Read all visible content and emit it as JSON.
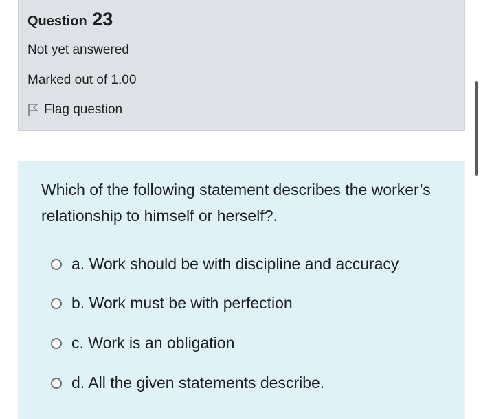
{
  "question": {
    "title_prefix": "Question",
    "number": "23",
    "state": "Not yet answered",
    "grade": "Marked out of 1.00",
    "flag_label": "Flag question",
    "text": "Which of the following statement describes the worker’s relationship to himself or herself?.",
    "answers": [
      {
        "label": "a. Work should be with discipline and accuracy"
      },
      {
        "label": "b. Work must be with perfection"
      },
      {
        "label": "c. Work is an obligation"
      },
      {
        "label": "d. All the given statements describe."
      }
    ]
  },
  "colors": {
    "info_background": "#dee2e6",
    "content_background": "#def2f8",
    "text": "#1d2125",
    "radio_border": "#6a737b"
  },
  "icons": {
    "flag": "flag-icon"
  }
}
